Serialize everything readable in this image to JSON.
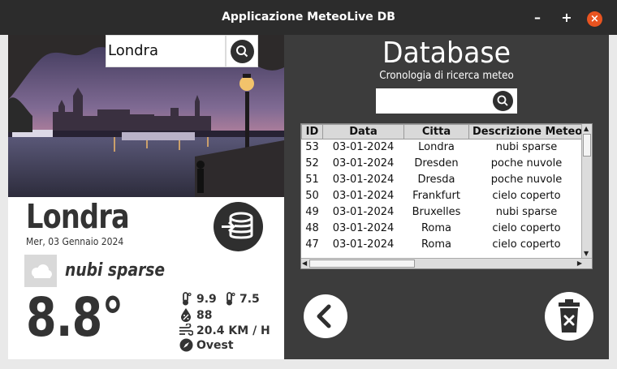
{
  "window": {
    "title": "Applicazione MeteoLive DB",
    "minimize_label": "–",
    "maximize_label": "+",
    "close_label": "×"
  },
  "weather": {
    "search_value": "Londra",
    "city": "Londra",
    "date": "Mer, 03 Gennaio 2024",
    "condition": "nubi sparse",
    "temperature": "8.8°",
    "temp_max": "9.9",
    "temp_min": "7.5",
    "humidity": "88",
    "wind": "20.4 KM / H",
    "wind_direction": "Ovest"
  },
  "database": {
    "title": "Database",
    "subtitle": "Cronologia di ricerca meteo",
    "search_value": "",
    "columns": [
      "ID",
      "Data",
      "Citta",
      "Descrizione Meteo"
    ],
    "rows": [
      [
        "53",
        "03-01-2024",
        "Londra",
        "nubi sparse"
      ],
      [
        "52",
        "03-01-2024",
        "Dresden",
        "poche nuvole"
      ],
      [
        "51",
        "03-01-2024",
        "Dresda",
        "poche nuvole"
      ],
      [
        "50",
        "03-01-2024",
        "Frankfurt",
        "cielo coperto"
      ],
      [
        "49",
        "03-01-2024",
        "Bruxelles",
        "nubi sparse"
      ],
      [
        "48",
        "03-01-2024",
        "Roma",
        "cielo coperto"
      ],
      [
        "47",
        "03-01-2024",
        "Roma",
        "cielo coperto"
      ]
    ]
  },
  "icons": {
    "search": "search-icon",
    "database": "database-import-icon",
    "cloud": "cloud-icon",
    "thermometer": "thermometer-icon",
    "humidity": "humidity-icon",
    "wind": "wind-icon",
    "compass": "compass-icon",
    "back": "chevron-left-icon",
    "trash": "trash-icon"
  },
  "colors": {
    "titlebar": "#2c2c2c",
    "right_panel": "#3c3c3c",
    "close_button": "#e95420",
    "dark_button": "#2f2f2f"
  }
}
